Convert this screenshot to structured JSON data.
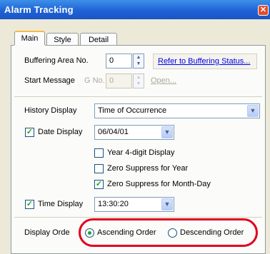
{
  "window": {
    "title": "Alarm Tracking",
    "close_glyph": "✕"
  },
  "tabs": [
    {
      "label": "Main"
    },
    {
      "label": "Style"
    },
    {
      "label": "Detail"
    }
  ],
  "buffering": {
    "label": "Buffering Area No.",
    "value": "0",
    "link": "Refer to Buffering Status..."
  },
  "start_message": {
    "label": "Start Message",
    "g_label": "G No.",
    "value": "0",
    "open_label": "Open..."
  },
  "history": {
    "label": "History Display",
    "value": "Time of Occurrence"
  },
  "date": {
    "label": "Date Display",
    "checked": true,
    "value": "06/04/01",
    "options": [
      {
        "label": "Year 4-digit Display",
        "checked": false
      },
      {
        "label": "Zero Suppress for Year",
        "checked": false
      },
      {
        "label": "Zero Suppress for Month-Day",
        "checked": true
      }
    ]
  },
  "time": {
    "label": "Time Display",
    "checked": true,
    "value": "13:30:20"
  },
  "display_order": {
    "label": "Display Orde",
    "ascending": "Ascending Order",
    "descending": "Descending Order",
    "selected": "ascending"
  },
  "icons": {
    "check": "✓",
    "dropdown": "▼",
    "spin_up": "▲",
    "spin_down": "▼"
  },
  "colors": {
    "title_bar": "#1f63d6",
    "highlight": "#e0001e",
    "tab_accent": "#f8b83e",
    "check": "#21a121"
  }
}
